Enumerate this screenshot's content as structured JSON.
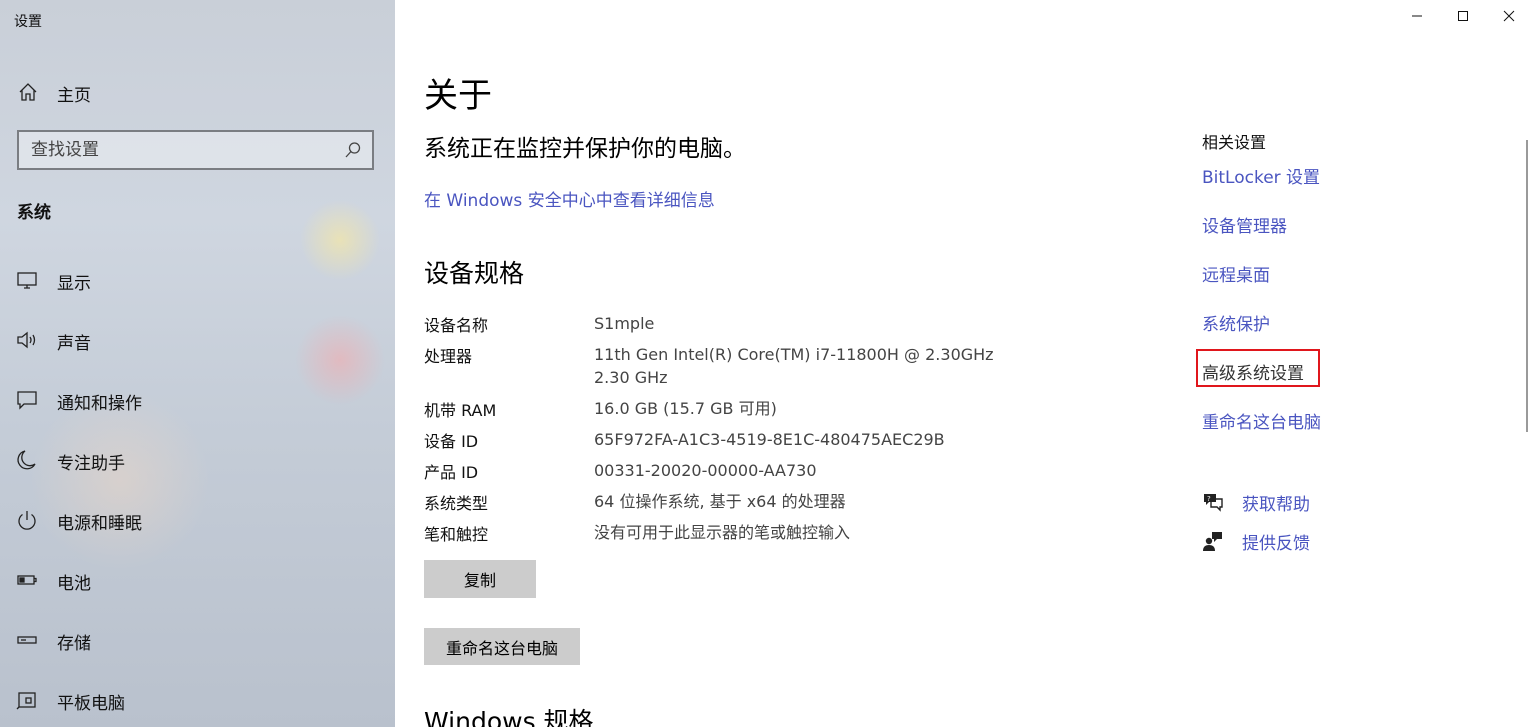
{
  "window": {
    "title": "设置",
    "controls": {
      "minimize": "minimize-icon",
      "maximize": "maximize-icon",
      "close": "close-icon"
    }
  },
  "sidebar": {
    "home_label": "主页",
    "search_placeholder": "查找设置",
    "section_title": "系统",
    "items": [
      {
        "label": "显示",
        "icon": "display-icon"
      },
      {
        "label": "声音",
        "icon": "speaker-icon"
      },
      {
        "label": "通知和操作",
        "icon": "notification-icon"
      },
      {
        "label": "专注助手",
        "icon": "moon-icon"
      },
      {
        "label": "电源和睡眠",
        "icon": "power-icon"
      },
      {
        "label": "电池",
        "icon": "battery-icon"
      },
      {
        "label": "存储",
        "icon": "storage-icon"
      },
      {
        "label": "平板电脑",
        "icon": "tablet-icon"
      }
    ]
  },
  "main": {
    "page_title": "关于",
    "protect_text": "系统正在监控并保护你的电脑。",
    "security_link": "在 Windows 安全中心中查看详细信息",
    "specs_title": "设备规格",
    "specs": [
      {
        "key": "设备名称",
        "value": "S1mple"
      },
      {
        "key": "处理器",
        "value": "11th Gen Intel(R) Core(TM) i7-11800H @ 2.30GHz",
        "value2": "2.30 GHz"
      },
      {
        "key": "机带 RAM",
        "value": "16.0 GB (15.7 GB 可用)"
      },
      {
        "key": "设备 ID",
        "value": "65F972FA-A1C3-4519-8E1C-480475AEC29B"
      },
      {
        "key": "产品 ID",
        "value": "00331-20020-00000-AA730"
      },
      {
        "key": "系统类型",
        "value": "64 位操作系统, 基于 x64 的处理器"
      },
      {
        "key": "笔和触控",
        "value": "没有可用于此显示器的笔或触控输入"
      }
    ],
    "copy_button": "复制",
    "rename_button": "重命名这台电脑",
    "windows_specs_title": "Windows 规格"
  },
  "related": {
    "title": "相关设置",
    "links": [
      {
        "label": "BitLocker 设置"
      },
      {
        "label": "设备管理器"
      },
      {
        "label": "远程桌面"
      },
      {
        "label": "系统保护"
      },
      {
        "label": "高级系统设置"
      },
      {
        "label": "重命名这台电脑"
      }
    ],
    "help": [
      {
        "label": "获取帮助",
        "icon": "help-chat-icon"
      },
      {
        "label": "提供反馈",
        "icon": "feedback-icon"
      }
    ]
  },
  "colors": {
    "link": "#4a55c0",
    "highlight_border": "#e0161c",
    "button_bg": "#cccccc"
  }
}
